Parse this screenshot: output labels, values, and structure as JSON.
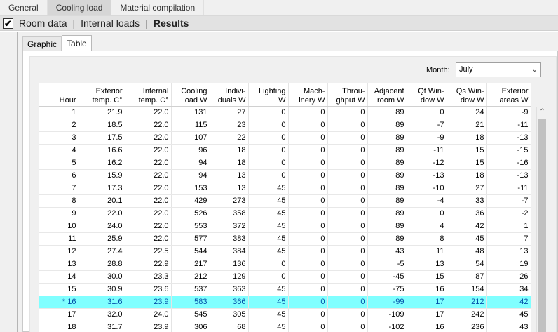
{
  "top_tabs": [
    {
      "label": "General"
    },
    {
      "label": "Cooling load"
    },
    {
      "label": "Material compilation"
    }
  ],
  "subbar": {
    "check_mark": "✔",
    "items": [
      "Room data",
      "Internal loads",
      "Results"
    ]
  },
  "inner_tabs": [
    "Graphic",
    "Table"
  ],
  "month": {
    "label": "Month:",
    "value": "July"
  },
  "table": {
    "headers": [
      [
        "Hour"
      ],
      [
        "Exterior",
        "temp. C°"
      ],
      [
        "Internal",
        "temp. C°"
      ],
      [
        "Cooling",
        "load W"
      ],
      [
        "Indivi-",
        "duals W"
      ],
      [
        "Lighting",
        "W"
      ],
      [
        "Mach-",
        "inery W"
      ],
      [
        "Throu-",
        "ghput W"
      ],
      [
        "Adjacent",
        "room W"
      ],
      [
        "Qt Win-",
        "dow W"
      ],
      [
        "Qs Win-",
        "dow W"
      ],
      [
        "Exterior",
        "areas W"
      ]
    ],
    "rows": [
      [
        "1",
        "21.9",
        "22.0",
        "131",
        "27",
        "0",
        "0",
        "0",
        "89",
        "0",
        "24",
        "-9"
      ],
      [
        "2",
        "18.5",
        "22.0",
        "115",
        "23",
        "0",
        "0",
        "0",
        "89",
        "-7",
        "21",
        "-11"
      ],
      [
        "3",
        "17.5",
        "22.0",
        "107",
        "22",
        "0",
        "0",
        "0",
        "89",
        "-9",
        "18",
        "-13"
      ],
      [
        "4",
        "16.6",
        "22.0",
        "96",
        "18",
        "0",
        "0",
        "0",
        "89",
        "-11",
        "15",
        "-15"
      ],
      [
        "5",
        "16.2",
        "22.0",
        "94",
        "18",
        "0",
        "0",
        "0",
        "89",
        "-12",
        "15",
        "-16"
      ],
      [
        "6",
        "15.9",
        "22.0",
        "94",
        "13",
        "0",
        "0",
        "0",
        "89",
        "-13",
        "18",
        "-13"
      ],
      [
        "7",
        "17.3",
        "22.0",
        "153",
        "13",
        "45",
        "0",
        "0",
        "89",
        "-10",
        "27",
        "-11"
      ],
      [
        "8",
        "20.1",
        "22.0",
        "429",
        "273",
        "45",
        "0",
        "0",
        "89",
        "-4",
        "33",
        "-7"
      ],
      [
        "9",
        "22.0",
        "22.0",
        "526",
        "358",
        "45",
        "0",
        "0",
        "89",
        "0",
        "36",
        "-2"
      ],
      [
        "10",
        "24.0",
        "22.0",
        "553",
        "372",
        "45",
        "0",
        "0",
        "89",
        "4",
        "42",
        "1"
      ],
      [
        "11",
        "25.9",
        "22.0",
        "577",
        "383",
        "45",
        "0",
        "0",
        "89",
        "8",
        "45",
        "7"
      ],
      [
        "12",
        "27.4",
        "22.5",
        "544",
        "384",
        "45",
        "0",
        "0",
        "43",
        "11",
        "48",
        "13"
      ],
      [
        "13",
        "28.8",
        "22.9",
        "217",
        "136",
        "0",
        "0",
        "0",
        "-5",
        "13",
        "54",
        "19"
      ],
      [
        "14",
        "30.0",
        "23.3",
        "212",
        "129",
        "0",
        "0",
        "0",
        "-45",
        "15",
        "87",
        "26"
      ],
      [
        "15",
        "30.9",
        "23.6",
        "537",
        "363",
        "45",
        "0",
        "0",
        "-75",
        "16",
        "154",
        "34"
      ],
      [
        "* 16",
        "31.6",
        "23.9",
        "583",
        "366",
        "45",
        "0",
        "0",
        "-99",
        "17",
        "212",
        "42"
      ],
      [
        "17",
        "32.0",
        "24.0",
        "545",
        "305",
        "45",
        "0",
        "0",
        "-109",
        "17",
        "242",
        "45"
      ],
      [
        "18",
        "31.7",
        "23.9",
        "306",
        "68",
        "45",
        "0",
        "0",
        "-102",
        "16",
        "236",
        "43"
      ]
    ],
    "selected_row": 15
  }
}
